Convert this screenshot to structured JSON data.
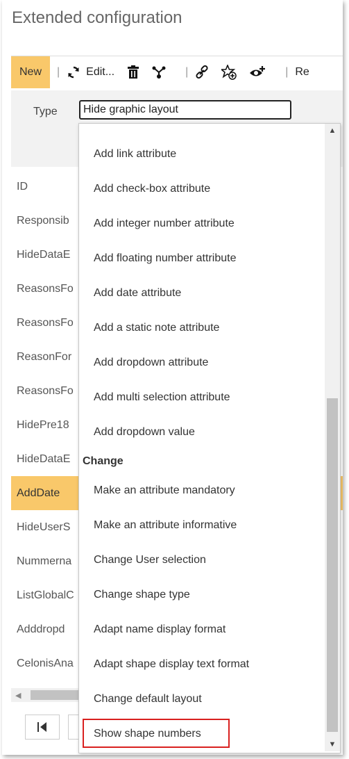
{
  "window": {
    "title": "Extended configuration"
  },
  "toolbar": {
    "new_label": "New",
    "edit_label": "Edit...",
    "truncated_label": "Re",
    "icons": [
      "refresh-icon",
      "delete-icon",
      "hierarchy-icon",
      "link-icon",
      "add-favorite-icon",
      "add-view-icon"
    ]
  },
  "type_field": {
    "label": "Type",
    "value": "Hide graphic layout"
  },
  "list": {
    "items": [
      "ID",
      "Responsib",
      "HideDataE",
      "ReasonsFo",
      "ReasonsFo",
      "ReasonFor",
      "ReasonsFo",
      "HidePre18",
      "HideDataE",
      "AddDate",
      "HideUserS",
      "Nummerna",
      "ListGlobalC",
      "Adddropd",
      "CelonisAna"
    ],
    "selected_index": 9
  },
  "dropdown": {
    "add_items": [
      "Add link attribute",
      "Add check-box attribute",
      "Add integer number attribute",
      "Add floating number attribute",
      "Add date attribute",
      "Add a static note attribute",
      "Add dropdown attribute",
      "Add multi selection attribute",
      "Add dropdown value"
    ],
    "change_group": "Change",
    "change_items": [
      "Make an attribute mandatory",
      "Make an attribute informative",
      "Change User selection",
      "Change shape type",
      "Adapt name display format",
      "Adapt shape display text format",
      "Change default layout"
    ],
    "highlighted_item": "Show shape numbers"
  },
  "colors": {
    "accent": "#f9c86a",
    "highlight_border": "#d9201f"
  }
}
